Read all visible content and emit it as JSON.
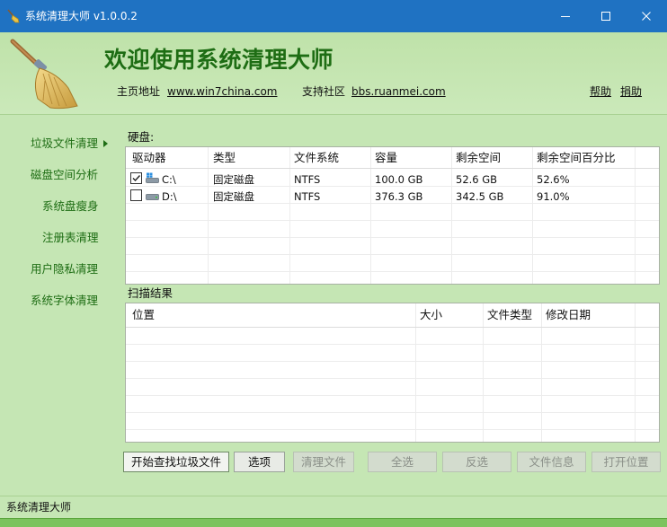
{
  "window": {
    "title": "系统清理大师 v1.0.0.2",
    "app_icon": "broom-icon",
    "controls": [
      "minimize-icon",
      "maximize-icon",
      "close-icon"
    ]
  },
  "header": {
    "welcome": "欢迎使用系统清理大师",
    "homepage_label": "主页地址",
    "homepage_url": "www.win7china.com",
    "community_label": "支持社区",
    "community_url": "bbs.ruanmei.com",
    "help_link": "帮助",
    "donate_link": "捐助"
  },
  "sidebar": {
    "items": [
      {
        "label": "垃圾文件清理",
        "active": true
      },
      {
        "label": "磁盘空间分析"
      },
      {
        "label": "系统盘瘦身"
      },
      {
        "label": "注册表清理"
      },
      {
        "label": "用户隐私清理"
      },
      {
        "label": "系统字体清理"
      }
    ]
  },
  "disks": {
    "label": "硬盘:",
    "columns": [
      "驱动器",
      "类型",
      "文件系统",
      "容量",
      "剩余空间",
      "剩余空间百分比"
    ],
    "rows": [
      {
        "checked": true,
        "drive": "C:\\",
        "icon": "windows-drive-icon",
        "type": "固定磁盘",
        "fs": "NTFS",
        "capacity": "100.0 GB",
        "free": "52.6 GB",
        "percent": "52.6%"
      },
      {
        "checked": false,
        "drive": "D:\\",
        "icon": "drive-icon",
        "type": "固定磁盘",
        "fs": "NTFS",
        "capacity": "376.3 GB",
        "free": "342.5 GB",
        "percent": "91.0%"
      }
    ]
  },
  "results": {
    "label": "扫描结果",
    "columns": [
      "位置",
      "大小",
      "文件类型",
      "修改日期"
    ]
  },
  "buttons": {
    "scan": "开始查找垃圾文件",
    "options": "选项",
    "clean": "清理文件",
    "select_all": "全选",
    "invert": "反选",
    "file_info": "文件信息",
    "open_location": "打开位置"
  },
  "status": {
    "text": "系统清理大师"
  },
  "colors": {
    "titlebar": "#1f72c2",
    "background": "#c5e6b4",
    "accent_green": "#1e6d14",
    "status_bar": "#7cc35e"
  }
}
